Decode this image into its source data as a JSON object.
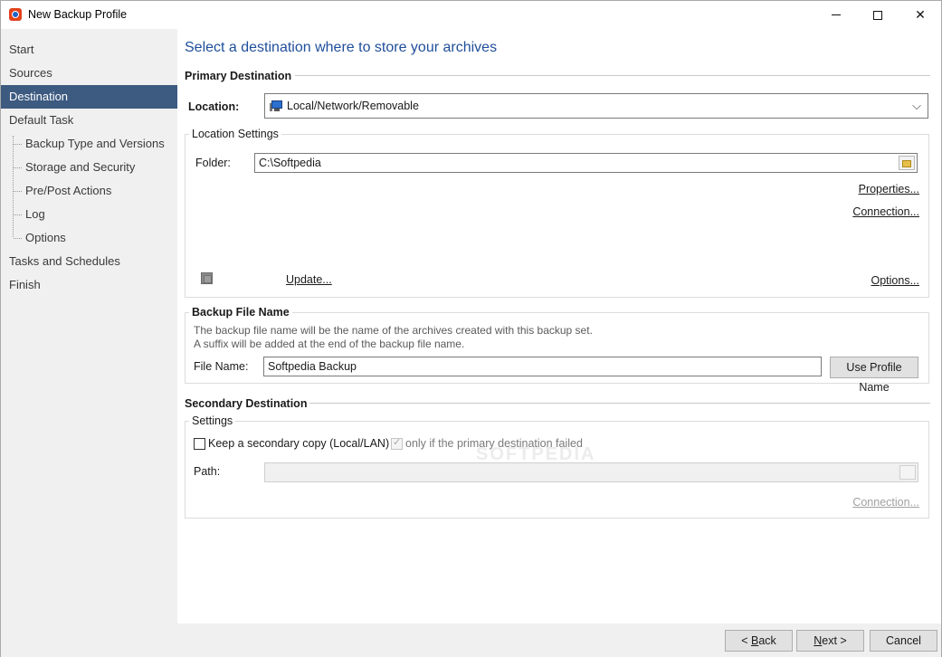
{
  "window": {
    "title": "New Backup Profile",
    "icon": "app-icon",
    "controls": {
      "minimize": "minimize-icon",
      "maximize": "maximize-icon",
      "close": "✕"
    }
  },
  "sidebar": {
    "items": [
      {
        "label": "Start",
        "level": 0,
        "active": false
      },
      {
        "label": "Sources",
        "level": 0,
        "active": false
      },
      {
        "label": "Destination",
        "level": 0,
        "active": true
      },
      {
        "label": "Default Task",
        "level": 0,
        "active": false
      },
      {
        "label": "Backup Type and Versions",
        "level": 1,
        "active": false
      },
      {
        "label": "Storage and Security",
        "level": 1,
        "active": false
      },
      {
        "label": "Pre/Post Actions",
        "level": 1,
        "active": false
      },
      {
        "label": "Log",
        "level": 1,
        "active": false
      },
      {
        "label": "Options",
        "level": 1,
        "active": false
      },
      {
        "label": "Tasks and Schedules",
        "level": 0,
        "active": false
      },
      {
        "label": "Finish",
        "level": 0,
        "active": false
      }
    ],
    "active_color": "#3d5a80"
  },
  "main": {
    "title": "Select a destination where to store your archives",
    "primary": {
      "header": "Primary Destination",
      "location_label": "Location:",
      "location_value": "Local/Network/Removable",
      "location_icon": "computer-icon",
      "settings_legend": "Location Settings",
      "folder_label": "Folder:",
      "folder_value": "C:\\Softpedia",
      "properties_link": "Properties...",
      "connection_link": "Connection...",
      "update_link": "Update...",
      "options_link": "Options..."
    },
    "backup_file": {
      "legend": "Backup File Name",
      "desc_line1": "The backup file name will be the name of the archives created with this backup set.",
      "desc_line2": "A suffix will be added at the end of the backup file name.",
      "file_name_label": "File Name:",
      "file_name_value": "Softpedia Backup",
      "use_profile_button": "Use Profile Name"
    },
    "secondary": {
      "header": "Secondary Destination",
      "settings_legend": "Settings",
      "keep_copy_label": "Keep a secondary copy (Local/LAN)",
      "keep_copy_checked": false,
      "only_if_failed_label": "only if the primary destination failed",
      "only_if_failed_checked": true,
      "path_label": "Path:",
      "path_value": "",
      "connection_link": "Connection..."
    }
  },
  "footer": {
    "back_prefix": "< ",
    "back_accel": "B",
    "back_rest": "ack",
    "next_accel": "N",
    "next_rest": "ext >",
    "cancel": "Cancel"
  },
  "watermark": "SOFTPEDIA"
}
